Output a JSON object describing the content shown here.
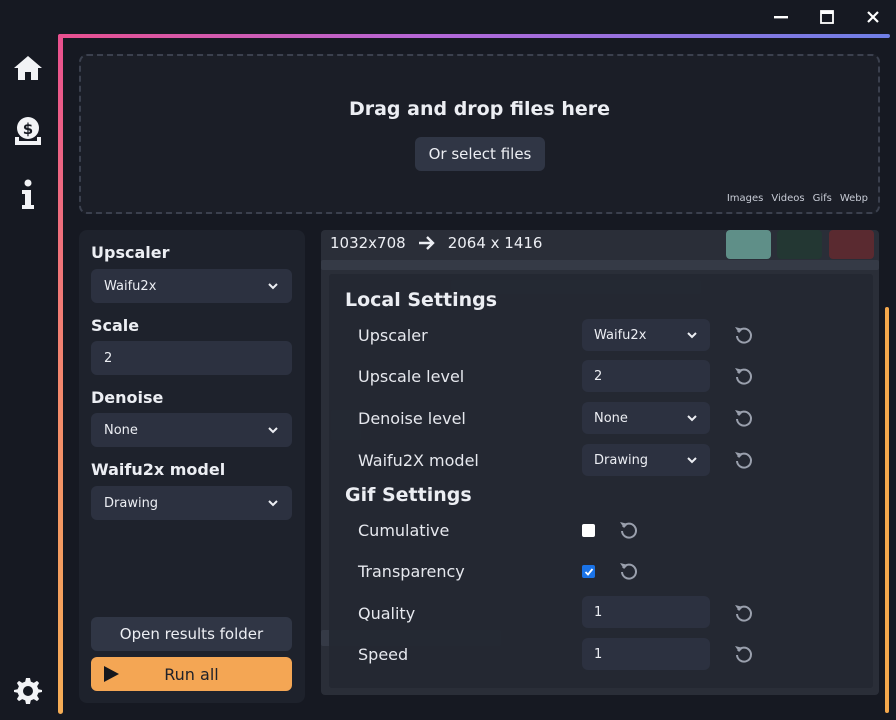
{
  "window": {
    "minimize_icon": "minimize-icon",
    "maximize_icon": "maximize-icon",
    "close_icon": "close-icon"
  },
  "nav": {
    "icons": [
      "home-icon",
      "donate-icon",
      "info-icon",
      "settings-icon"
    ]
  },
  "dropzone": {
    "title": "Drag and drop files here",
    "select_button": "Or select files",
    "formats": [
      "Images",
      "Videos",
      "Gifs",
      "Webp"
    ]
  },
  "sidebar": {
    "upscaler_label": "Upscaler",
    "upscaler_value": "Waifu2x",
    "scale_label": "Scale",
    "scale_value": "2",
    "denoise_label": "Denoise",
    "denoise_value": "None",
    "model_label": "Waifu2x model",
    "model_value": "Drawing",
    "open_folder_button": "Open results folder",
    "run_all_button": "Run all"
  },
  "preview": {
    "source_resolution": "1032x708",
    "target_resolution": "2064 x 1416",
    "swatch_colors": [
      "#5f8f88",
      "#233733",
      "#5a2a30"
    ]
  },
  "local_settings": {
    "title": "Local Settings",
    "upscaler_label": "Upscaler",
    "upscaler_value": "Waifu2x",
    "upscale_level_label": "Upscale level",
    "upscale_level_value": "2",
    "denoise_level_label": "Denoise level",
    "denoise_level_value": "None",
    "model_label": "Waifu2X model",
    "model_value": "Drawing"
  },
  "gif_settings": {
    "title": "Gif Settings",
    "cumulative_label": "Cumulative",
    "cumulative_checked": false,
    "transparency_label": "Transparency",
    "transparency_checked": true,
    "quality_label": "Quality",
    "quality_value": "1",
    "speed_label": "Speed",
    "speed_value": "1"
  },
  "colors": {
    "accent": "#f4a654",
    "gradient_start": "#e9508f",
    "gradient_end": "#6f7fe6",
    "checkbox": "#1a73e8"
  }
}
